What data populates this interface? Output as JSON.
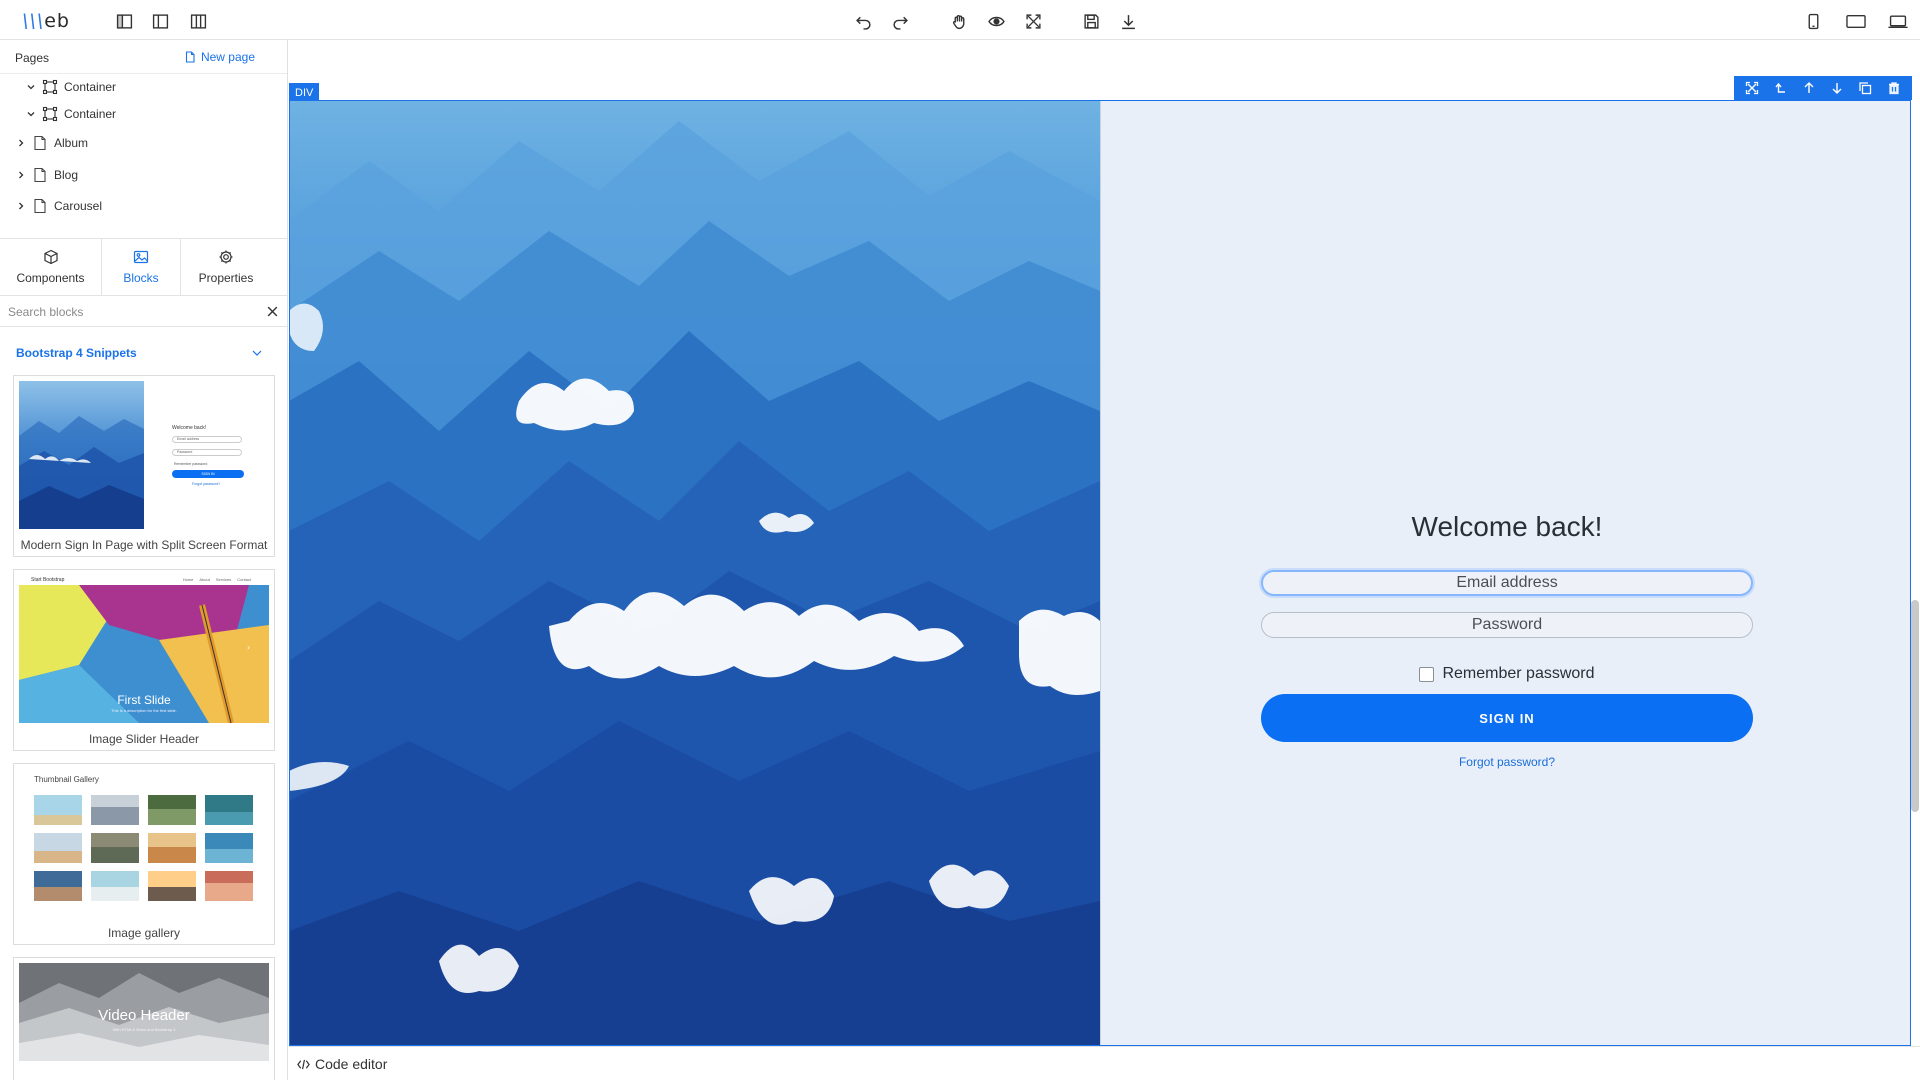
{
  "app": {
    "logo_prefix": "\\\\\\",
    "logo_text": "eb"
  },
  "toolbar": {
    "icons": [
      "layout-left-icon",
      "layout-center-icon",
      "layout-right-icon",
      "undo-icon",
      "redo-icon",
      "hand-icon",
      "preview-eye-icon",
      "fullscreen-icon",
      "save-icon",
      "download-icon",
      "mobile-view-icon",
      "tablet-view-icon",
      "desktop-view-icon"
    ]
  },
  "pages_panel": {
    "title": "Pages",
    "new_page_label": "New page",
    "tree": [
      {
        "label": "Container",
        "type": "container"
      },
      {
        "label": "Container",
        "type": "container"
      },
      {
        "label": "Album",
        "type": "page"
      },
      {
        "label": "Blog",
        "type": "page"
      },
      {
        "label": "Carousel",
        "type": "page"
      }
    ]
  },
  "tabs": [
    {
      "label": "Components",
      "icon": "cube-icon"
    },
    {
      "label": "Blocks",
      "icon": "image-icon",
      "active": true
    },
    {
      "label": "Properties",
      "icon": "gear-icon"
    }
  ],
  "search": {
    "placeholder": "Search blocks",
    "value": ""
  },
  "blocks_group": {
    "title": "Bootstrap 4 Snippets",
    "items": [
      {
        "label": "Modern Sign In Page with Split Screen Format",
        "thumb": {
          "welcome": "Welcome back!",
          "email": "Email address",
          "password": "Password",
          "remember": "Remember password",
          "button": "SIGN IN",
          "forgot": "Forgot password?"
        }
      },
      {
        "label": "Image Slider Header",
        "thumb": {
          "brand": "Start Bootstrap",
          "nav": [
            "Home",
            "About",
            "Services",
            "Contact"
          ],
          "slide_title": "First Slide",
          "slide_text": "This is a description for the first slide."
        }
      },
      {
        "label": "Image gallery",
        "thumb": {
          "title": "Thumbnail Gallery"
        }
      },
      {
        "label": "Video Header",
        "thumb": {
          "title": "Video Header",
          "subtitle": "With HTML5 Video and Bootstrap 4"
        }
      }
    ]
  },
  "canvas": {
    "selected_tag": "DIV",
    "selection_tools": [
      "fullscreen-select-icon",
      "select-parent-icon",
      "move-up-icon",
      "move-down-icon",
      "duplicate-icon",
      "delete-icon"
    ],
    "login": {
      "title": "Welcome back!",
      "email_placeholder": "Email address",
      "password_placeholder": "Password",
      "remember_label": "Remember password",
      "signin_label": "SIGN IN",
      "forgot_label": "Forgot password?"
    }
  },
  "bottombar": {
    "code_editor_label": "Code editor"
  },
  "colors": {
    "accent": "#1a73e8",
    "signin_button": "#0a6ff2",
    "login_background": "#e9eff9"
  }
}
